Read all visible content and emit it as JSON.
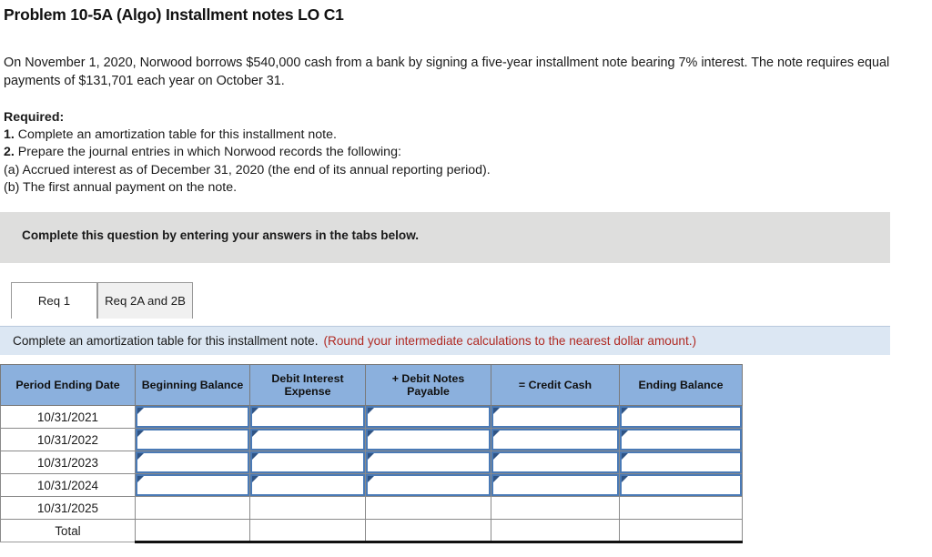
{
  "problem": {
    "title": "Problem 10-5A (Algo) Installment notes LO C1",
    "intro": "On November 1, 2020, Norwood borrows $540,000 cash from a bank by signing a five-year installment note bearing 7% interest. The note requires equal payments of $131,701 each year on October 31."
  },
  "required": {
    "heading": "Required:",
    "items": [
      {
        "num": "1.",
        "text": " Complete an amortization table for this installment note."
      },
      {
        "num": "2.",
        "text": " Prepare the journal entries in which Norwood records the following:"
      },
      {
        "num": "",
        "text": "(a) Accrued interest as of December 31, 2020 (the end of its annual reporting period)."
      },
      {
        "num": "",
        "text": "(b) The first annual payment on the note."
      }
    ]
  },
  "banner": {
    "text": "Complete this question by entering your answers in the tabs below."
  },
  "tabs": [
    {
      "label": "Req 1",
      "active": true
    },
    {
      "label": "Req 2A and 2B",
      "active": false
    }
  ],
  "instruction": {
    "main": "Complete an amortization table for this installment note.",
    "note": "(Round your intermediate calculations to the nearest dollar amount.)",
    "note_color": "#b02a23",
    "background": "#dce7f3"
  },
  "table": {
    "header_color": "#8bb0dd",
    "input_border_color": "#4a7ab6",
    "columns": [
      "Period Ending Date",
      "Beginning Balance",
      "Debit Interest Expense",
      "+ Debit Notes Payable",
      "= Credit Cash",
      "Ending Balance"
    ],
    "rows": [
      {
        "period": "10/31/2021",
        "inputs": [
          "",
          "",
          "",
          "",
          ""
        ],
        "boxed": true
      },
      {
        "period": "10/31/2022",
        "inputs": [
          "",
          "",
          "",
          "",
          ""
        ],
        "boxed": true
      },
      {
        "period": "10/31/2023",
        "inputs": [
          "",
          "",
          "",
          "",
          ""
        ],
        "boxed": true
      },
      {
        "period": "10/31/2024",
        "inputs": [
          "",
          "",
          "",
          "",
          ""
        ],
        "boxed": true
      },
      {
        "period": "10/31/2025",
        "inputs": [
          "",
          "",
          "",
          "",
          ""
        ],
        "boxed": false
      },
      {
        "period": "Total",
        "inputs": [
          "",
          "",
          "",
          "",
          ""
        ],
        "boxed": false
      }
    ]
  }
}
